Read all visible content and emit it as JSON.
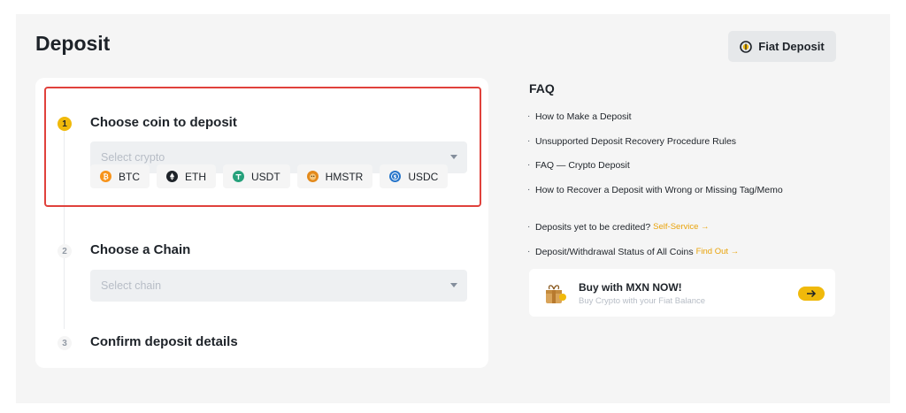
{
  "page": {
    "title": "Deposit",
    "fiat_button_label": "Fiat Deposit"
  },
  "steps": [
    {
      "number": "1",
      "title": "Choose coin to deposit",
      "select_placeholder": "Select crypto"
    },
    {
      "number": "2",
      "title": "Choose a Chain",
      "select_placeholder": "Select chain"
    },
    {
      "number": "3",
      "title": "Confirm deposit details"
    }
  ],
  "coins": [
    {
      "symbol": "BTC",
      "color": "#f7931a",
      "icon": "btc-icon"
    },
    {
      "symbol": "ETH",
      "color": "#1e2329",
      "icon": "eth-icon"
    },
    {
      "symbol": "USDT",
      "color": "#26a17b",
      "icon": "usdt-icon"
    },
    {
      "symbol": "HMSTR",
      "color": "#e38a1c",
      "icon": "hmstr-icon"
    },
    {
      "symbol": "USDC",
      "color": "#2775ca",
      "icon": "usdc-icon"
    }
  ],
  "faq": {
    "title": "FAQ",
    "items": [
      "How to Make a Deposit",
      "Unsupported Deposit Recovery Procedure Rules",
      "FAQ — Crypto Deposit",
      "How to Recover a Deposit with Wrong or Missing Tag/Memo"
    ],
    "extra": [
      {
        "text": "Deposits yet to be credited?",
        "link": "Self-Service →"
      },
      {
        "text": "Deposit/Withdrawal Status of All Coins",
        "link": "Find Out →"
      }
    ]
  },
  "promo": {
    "title": "Buy with MXN NOW!",
    "subtitle": "Buy Crypto with your Fiat Balance"
  },
  "colors": {
    "accent": "#f0b90b",
    "highlight_border": "#e0413c",
    "link": "#e9a30a"
  }
}
